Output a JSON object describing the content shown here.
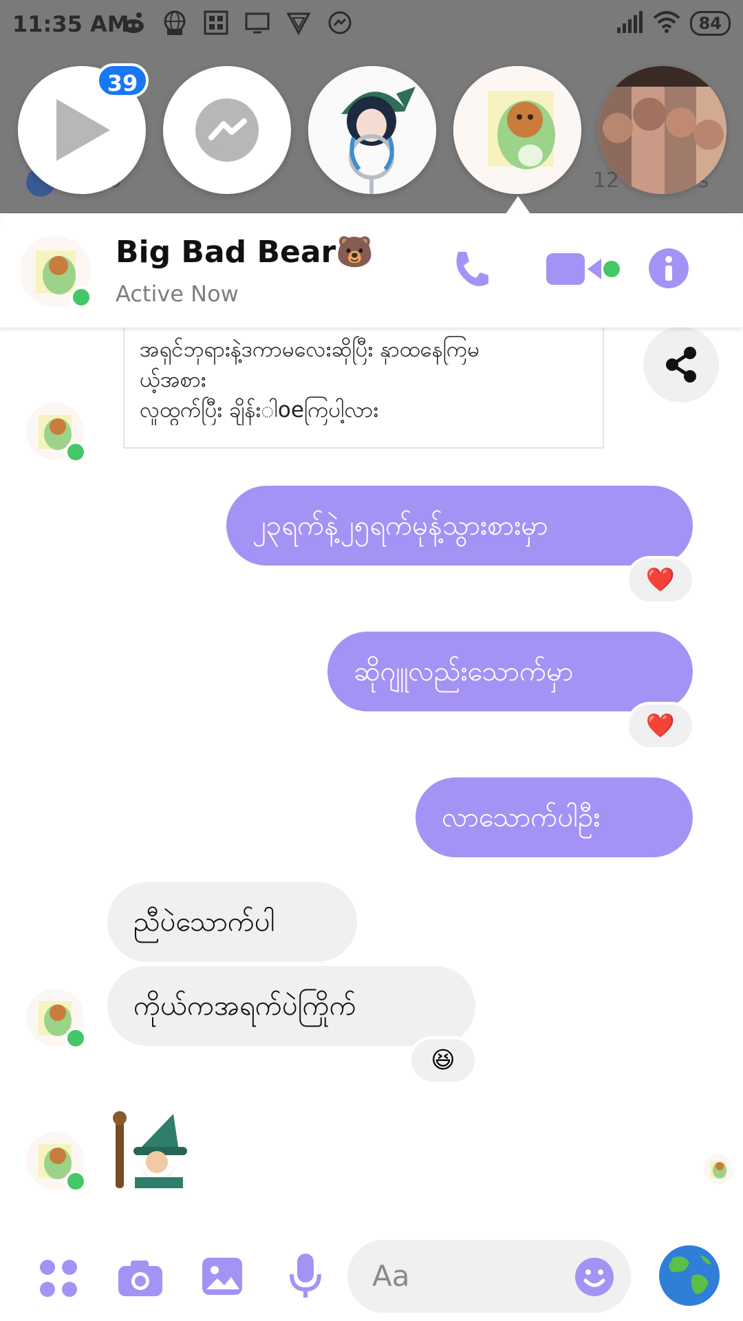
{
  "status_bar": {
    "time": "11:35 AM",
    "battery": "84",
    "icons": [
      "reddit-icon",
      "globe-live-icon",
      "grid-app-icon",
      "cast-icon",
      "vpn-icon",
      "messenger-icon"
    ]
  },
  "background": {
    "count_left": "0",
    "count_right": "12",
    "count_right_suffix": "ws"
  },
  "chat_heads": {
    "badge_count": "39",
    "items": [
      "video-play-head",
      "messenger-head",
      "anime-character-head",
      "big-bad-bear-head",
      "group-selfie-head"
    ]
  },
  "conversation": {
    "name": "Big Bad Bear🐻",
    "status": "Active Now",
    "accent_color": "#a592f5",
    "online_color": "#44c767"
  },
  "messages": {
    "quote_lines": [
      "အရှင်ဘုရားနဲ့ဒကာမလေးဆိုပြီး နှာထနေကြမ",
      "ယ့်အစား",
      "လူထွက်ပြီး ချိန်းါoeကြပါ့လား"
    ],
    "out_1": "၂၃ရက်နဲ့၂၅ရက်မုန့်သွားစားမှာ",
    "out_1_reaction": "❤️",
    "out_2": "ဆိုဂျူလည်းသောက်မှာ",
    "out_2_reaction": "❤️",
    "out_3": "လာသောက်ပါဦး",
    "in_1": "ညီပဲသောက်ပါ",
    "in_2": "ကိုယ်ကအရက်ပဲကြိုက်",
    "in_2_reaction": "😆"
  },
  "composer": {
    "placeholder": "Aa"
  }
}
